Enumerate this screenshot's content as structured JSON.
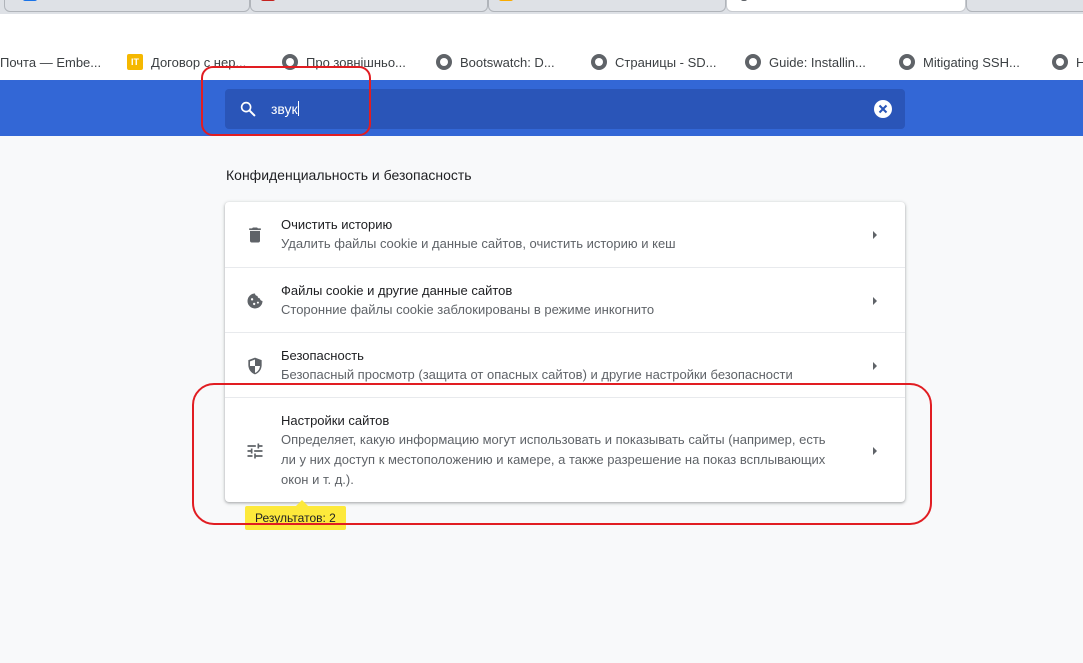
{
  "bookmarks": [
    {
      "label": "Почта — Embe...",
      "icon": "mail-icon"
    },
    {
      "label": "Договор с нер...",
      "icon": "it-icon"
    },
    {
      "label": "Про зовнішньо...",
      "icon": "globe-icon"
    },
    {
      "label": "Bootswatch: D...",
      "icon": "globe-icon"
    },
    {
      "label": "Страницы - SD...",
      "icon": "globe-icon"
    },
    {
      "label": "Guide: Installin...",
      "icon": "globe-icon"
    },
    {
      "label": "Mitigating SSH...",
      "icon": "globe-icon"
    },
    {
      "label": "H",
      "icon": "globe-icon"
    }
  ],
  "search": {
    "value": "звук",
    "icon": "search-icon"
  },
  "section": {
    "title": "Конфиденциальность и безопасность"
  },
  "items": [
    {
      "title": "Очистить историю",
      "description": "Удалить файлы cookie и данные сайтов, очистить историю и кеш",
      "icon": "trash-icon"
    },
    {
      "title": "Файлы cookie и другие данные сайтов",
      "description": "Сторонние файлы cookie заблокированы в режиме инкогнито",
      "icon": "cookie-icon"
    },
    {
      "title": "Безопасность",
      "description": "Безопасный просмотр (защита от опасных сайтов) и другие настройки безопасности",
      "icon": "shield-icon"
    },
    {
      "title": "Настройки сайтов",
      "description_lines": [
        "Определяет, какую информацию могут использовать и показывать сайты (например, есть",
        "ли у них доступ к местоположению и камере, а также разрешение на показ всплывающих",
        "окон и т. д.)."
      ],
      "icon": "tune-icon"
    }
  ],
  "results_badge": "Результатов: 2",
  "colors": {
    "header": "#3367d6",
    "search_bg": "#2a55b8",
    "badge": "#fde93b",
    "annotation": "#e11d22"
  }
}
